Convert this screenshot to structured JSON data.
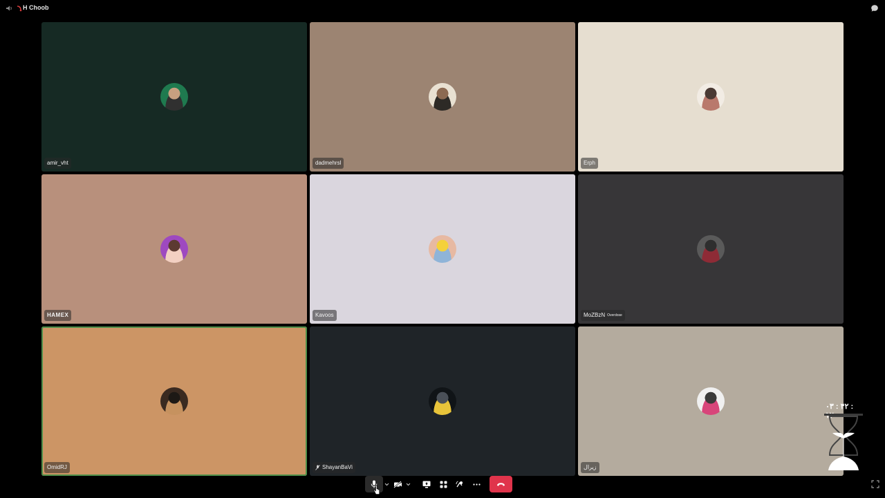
{
  "window": {
    "title": "H Choob"
  },
  "participants": [
    {
      "name": "amir_vht",
      "bg": "#162a24",
      "avatar_colors": [
        "#1f7a4f",
        "#303030",
        "#c8a080"
      ],
      "speaking": false
    },
    {
      "name": "dadmehrsl",
      "bg": "#9c8472",
      "avatar_colors": [
        "#e9e1d2",
        "#2d2a26",
        "#8c6a52"
      ],
      "speaking": false
    },
    {
      "name": "Erph",
      "bg": "#e6ded0",
      "avatar_colors": [
        "#f2ece4",
        "#b9796c",
        "#4a3a34"
      ],
      "speaking": false
    },
    {
      "name": "HAMEX",
      "bg": "#b8907c",
      "avatar_colors": [
        "#9e49c0",
        "#f3d0c2",
        "#5c3a32"
      ],
      "speaking": false,
      "bold": true
    },
    {
      "name": "Kavoos",
      "bg": "#dad6de",
      "avatar_colors": [
        "#e7b9a2",
        "#8fb4d8",
        "#f4d13a"
      ],
      "speaking": false
    },
    {
      "name": "MoZBzN",
      "name_suffix": "Overdose",
      "bg": "#373638",
      "avatar_colors": [
        "#5a5a5a",
        "#8e2b36",
        "#2e2e2e"
      ],
      "speaking": false
    },
    {
      "name": "OmidRJ",
      "bg": "#cc9565",
      "avatar_colors": [
        "#3a2a20",
        "#c6925f",
        "#1d1915"
      ],
      "speaking": true
    },
    {
      "name": "ShayanBaVi",
      "bg": "#1f2428",
      "avatar_colors": [
        "#101417",
        "#e8c43a",
        "#4a5058"
      ],
      "speaking": false,
      "muted": true
    },
    {
      "name": "زیرال",
      "bg": "#b4ab9e",
      "avatar_colors": [
        "#f0f0f0",
        "#d8457a",
        "#3a3a3a"
      ],
      "speaking": false
    }
  ],
  "controls": {
    "mic_icon": "microphone-icon",
    "camera_icon": "camera-off-icon",
    "share_icon": "screen-share-icon",
    "activities_icon": "activities-icon",
    "soundboard_icon": "soundboard-icon",
    "more_icon": "more-icon",
    "hangup_icon": "hang-up-icon",
    "hangup_color": "#e0344b"
  },
  "timer": {
    "text": "۰۳ : ۴۲ : ۱۲"
  },
  "colors": {
    "speaking_outline": "#4e8f4a",
    "chip_bg": "rgba(40,40,40,0.55)"
  }
}
